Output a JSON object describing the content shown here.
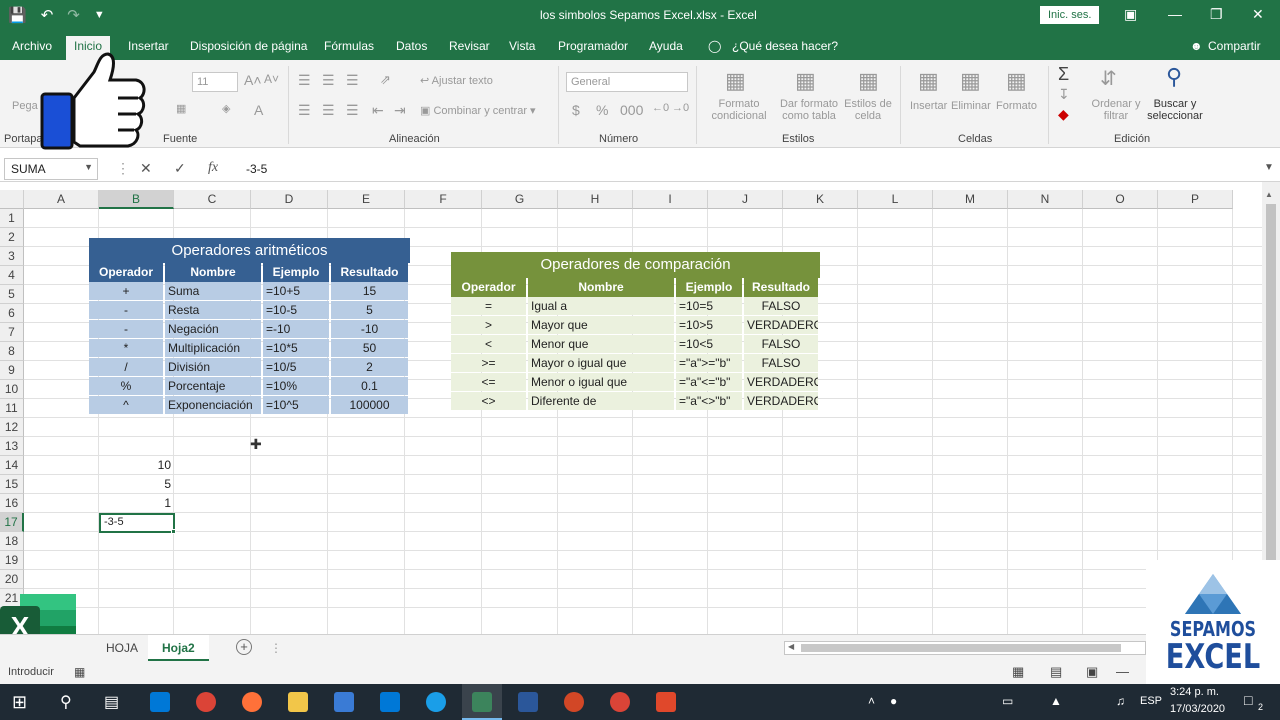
{
  "window": {
    "title": "los simbolos Sepamos Excel.xlsx  -  Excel",
    "signin": "Inic. ses."
  },
  "menu": [
    "Archivo",
    "Inicio",
    "Insertar",
    "Disposición de página",
    "Fórmulas",
    "Datos",
    "Revisar",
    "Vista",
    "Programador",
    "Ayuda",
    "¿Qué desea hacer?",
    "Compartir"
  ],
  "ribbon": {
    "font_size": "11",
    "font_group": "Fuente",
    "clipboard_group": "Portapa",
    "paste": "Pega",
    "wrap_text": "Ajustar texto",
    "merge": "Combinar y centrar",
    "align_group": "Alineación",
    "number_format": "General",
    "number_group": "Número",
    "cond_format": "Formato\ncondicional",
    "format_table": "Dar formato\ncomo tabla",
    "cell_styles": "Estilos de\ncelda",
    "styles_group": "Estilos",
    "insert": "Insertar",
    "delete": "Eliminar",
    "format": "Formato",
    "cells_group": "Celdas",
    "sort": "Ordenar y\nfiltrar",
    "find": "Buscar y\nseleccionar",
    "edit_group": "Edición"
  },
  "formula": {
    "namebox": "SUMA",
    "value": "-3-5"
  },
  "columns": [
    "A",
    "B",
    "C",
    "D",
    "E",
    "F",
    "G",
    "H",
    "I",
    "J",
    "K",
    "L",
    "M",
    "N",
    "O",
    "P"
  ],
  "rows": [
    "1",
    "2",
    "3",
    "4",
    "5",
    "6",
    "7",
    "8",
    "9",
    "10",
    "11",
    "12",
    "13",
    "14",
    "15",
    "16",
    "17",
    "18",
    "19",
    "20",
    "21"
  ],
  "arith": {
    "title": "Operadores aritméticos",
    "headers": [
      "Operador",
      "Nombre",
      "Ejemplo",
      "Resultado"
    ],
    "rows": [
      [
        "+",
        "Suma",
        "=10+5",
        "15"
      ],
      [
        "-",
        "Resta",
        "=10-5",
        "5"
      ],
      [
        "-",
        "Negación",
        "=-10",
        "-10"
      ],
      [
        "*",
        "Multiplicación",
        "=10*5",
        "50"
      ],
      [
        "/",
        "División",
        "=10/5",
        "2"
      ],
      [
        "%",
        "Porcentaje",
        "=10%",
        "0.1"
      ],
      [
        "^",
        "Exponenciación",
        "=10^5",
        "100000"
      ]
    ]
  },
  "comp": {
    "title": "Operadores de comparación",
    "headers": [
      "Operador",
      "Nombre",
      "Ejemplo",
      "Resultado"
    ],
    "rows": [
      [
        "=",
        "Igual a",
        "=10=5",
        "FALSO"
      ],
      [
        ">",
        "Mayor que",
        "=10>5",
        "VERDADERO"
      ],
      [
        "<",
        "Menor que",
        "=10<5",
        "FALSO"
      ],
      [
        ">=",
        "Mayor o igual que",
        "=\"a\">=\"b\"",
        "FALSO"
      ],
      [
        "<=",
        "Menor o igual que",
        "=\"a\"<=\"b\"",
        "VERDADERO"
      ],
      [
        "<>",
        "Diferente de",
        "=\"a\"<>\"b\"",
        "VERDADERO"
      ]
    ]
  },
  "cells": {
    "b14": "10",
    "b15": "5",
    "b16": "1",
    "b17": "-3-5"
  },
  "tabs": [
    "HOJA",
    "Hoja2"
  ],
  "status": "Introducir",
  "tray": {
    "lang": "ESP",
    "time": "3:24 p. m.",
    "date": "17/03/2020",
    "notif": "2"
  },
  "logo": {
    "line1": "SEPAMOS",
    "line2": "EXCEL"
  },
  "colors": {
    "excel_green": "#217346",
    "arith_header": "#366092",
    "arith_row": "#b8cce4",
    "comp_header": "#76923c",
    "comp_row": "#ebf1de"
  }
}
